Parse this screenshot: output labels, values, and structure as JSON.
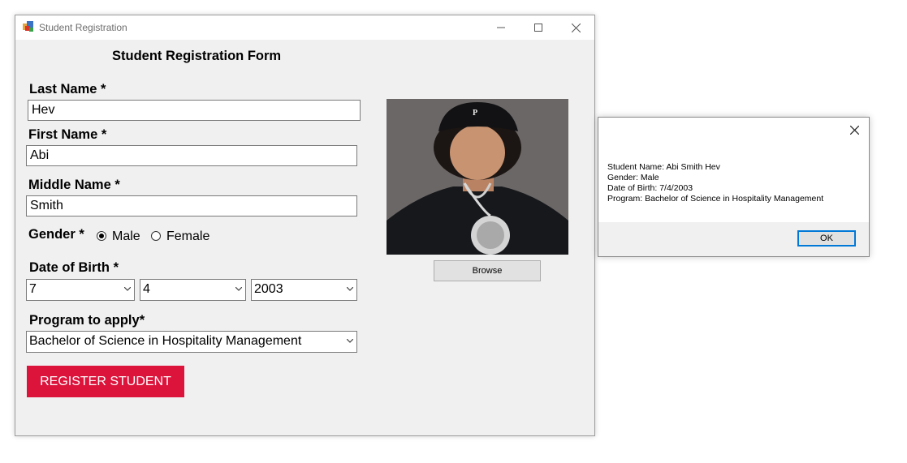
{
  "window": {
    "title": "Student Registration",
    "minimize_icon": "minimize-icon",
    "maximize_icon": "maximize-icon",
    "close_icon": "close-icon"
  },
  "form": {
    "title": "Student Registration Form",
    "last_name": {
      "label": "Last Name *",
      "value": "Hev"
    },
    "first_name": {
      "label": "First Name *",
      "value": "Abi"
    },
    "middle_name": {
      "label": "Middle Name *",
      "value": "Smith"
    },
    "gender": {
      "label": "Gender *",
      "options": [
        {
          "label": "Male",
          "selected": true
        },
        {
          "label": "Female",
          "selected": false
        }
      ]
    },
    "dob": {
      "label": "Date of Birth *",
      "month": "7",
      "day": "4",
      "year": "2003"
    },
    "program": {
      "label": "Program to apply*",
      "value": "Bachelor of Science in Hospitality Management"
    },
    "browse_label": "Browse",
    "register_label": "REGISTER STUDENT",
    "register_color": "#dc143c"
  },
  "message_box": {
    "lines": [
      "Student Name: Abi Smith Hev",
      "Gender: Male",
      "Date of Birth: 7/4/2003",
      "Program: Bachelor of Science in Hospitality Management"
    ],
    "ok_label": "OK",
    "accent": "#0078d7"
  }
}
